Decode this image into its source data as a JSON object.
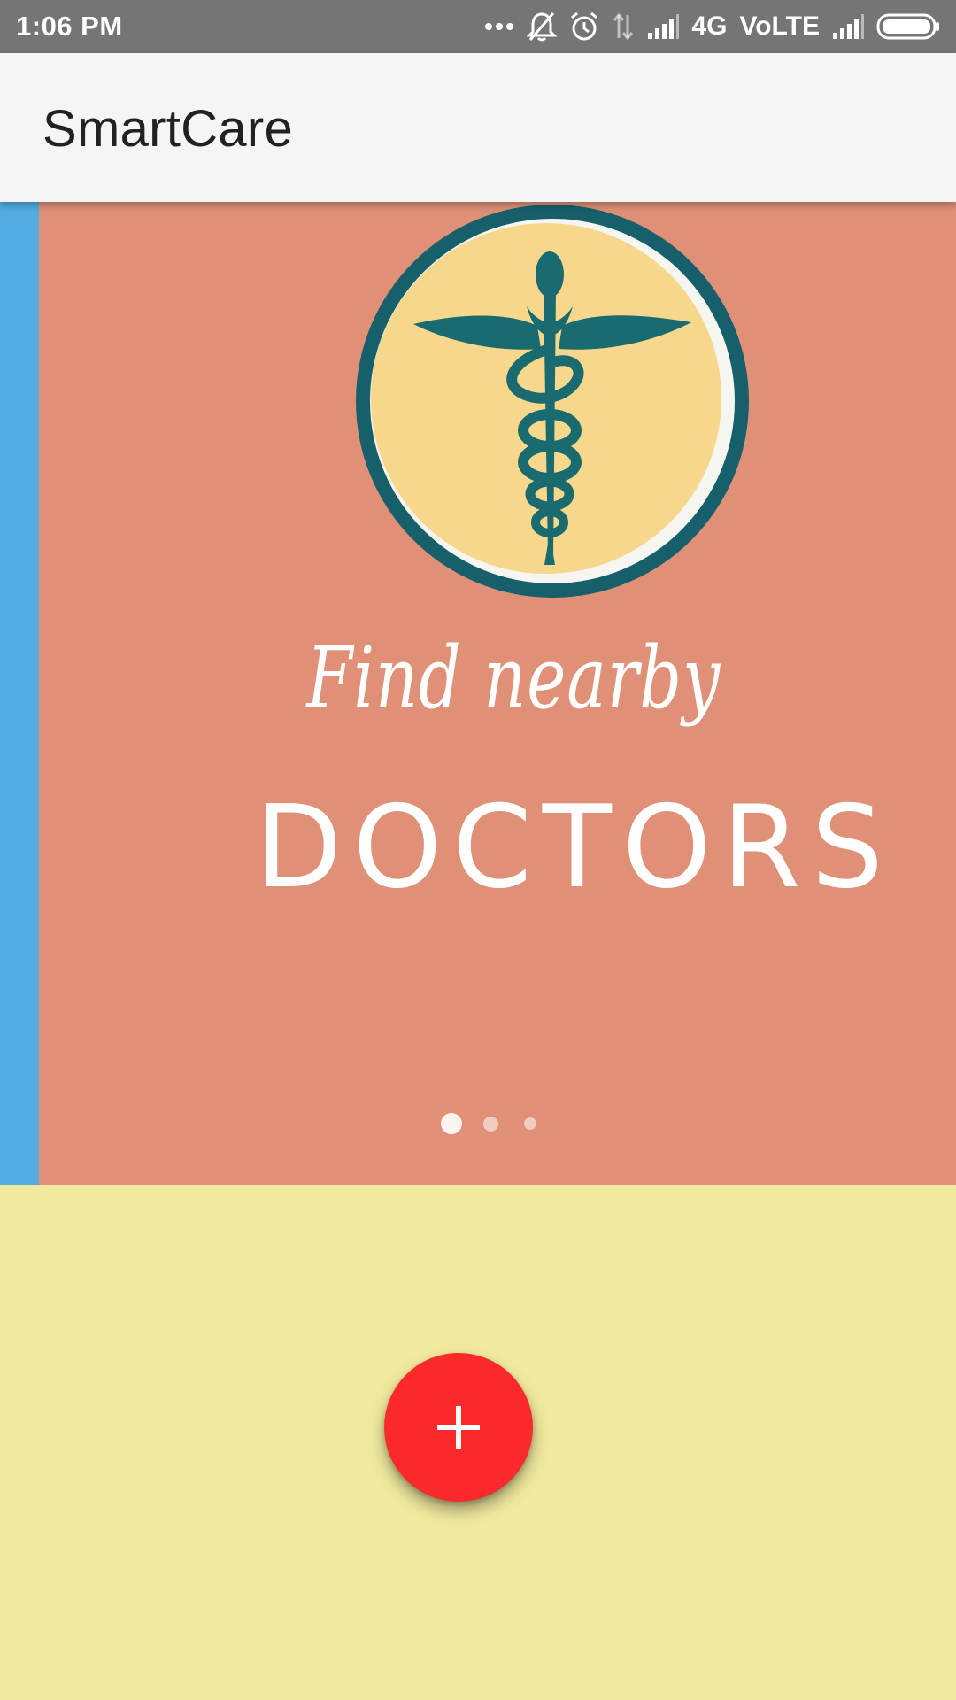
{
  "status_bar": {
    "time": "1:06 PM",
    "network": "4G",
    "volte": "VoLTE",
    "icons": [
      "more-dots-icon",
      "notifications-off-icon",
      "alarm-icon",
      "data-arrows-icon",
      "signal-icon",
      "signal-icon",
      "battery-icon"
    ]
  },
  "app_bar": {
    "title": "SmartCare"
  },
  "carousel": {
    "current_index": 1,
    "total_slides": 3,
    "slide": {
      "line_1": "Find nearby",
      "line_2": "DOCTORS",
      "logo_icon": "caduceus-icon"
    },
    "colors": {
      "slide_background": "#df9076",
      "previous_slide_edge": "#53ade3",
      "logo_fill": "#f7d78c",
      "logo_dark": "#1a6b70"
    }
  },
  "fab": {
    "icon": "plus-icon",
    "color": "#fb2a2a"
  },
  "colors": {
    "status_bar": "#757575",
    "app_bar": "#f5f5f5",
    "page_background": "#f1ea9e"
  }
}
